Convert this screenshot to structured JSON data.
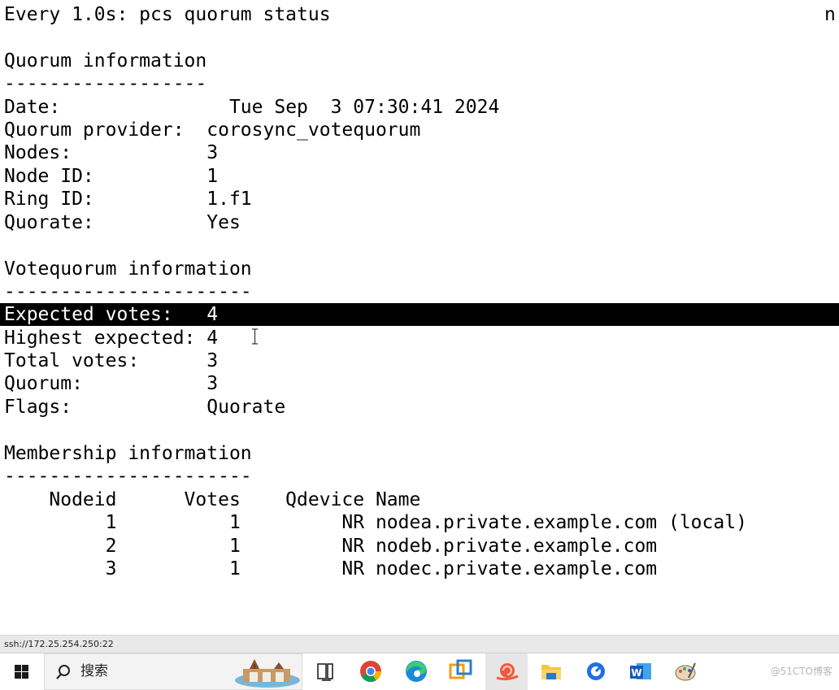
{
  "terminal": {
    "header": "Every 1.0s: pcs quorum status",
    "header_right": "n",
    "quorum_title": "Quorum information",
    "quorum_sep": "------------------",
    "quorum_rows": [
      {
        "label": "Date:               ",
        "value": "Tue Sep  3 07:30:41 2024"
      },
      {
        "label": "Quorum provider:  ",
        "value": "corosync_votequorum"
      },
      {
        "label": "Nodes:            ",
        "value": "3"
      },
      {
        "label": "Node ID:          ",
        "value": "1"
      },
      {
        "label": "Ring ID:          ",
        "value": "1.f1"
      },
      {
        "label": "Quorate:          ",
        "value": "Yes"
      }
    ],
    "vote_title": "Votequorum information",
    "vote_sep": "----------------------",
    "vote_rows": [
      {
        "label": "Expected votes:   ",
        "value": "4"
      },
      {
        "label": "Highest expected: ",
        "value": "4"
      },
      {
        "label": "Total votes:      ",
        "value": "3"
      },
      {
        "label": "Quorum:           ",
        "value": "3"
      },
      {
        "label": "Flags:            ",
        "value": "Quorate"
      }
    ],
    "member_title": "Membership information",
    "member_sep": "----------------------",
    "member_header": "    Nodeid      Votes    Qdevice Name",
    "member_rows": [
      "         1          1         NR nodea.private.example.com (local)",
      "         2          1         NR nodeb.private.example.com",
      "         3          1         NR nodec.private.example.com"
    ]
  },
  "statusbar": {
    "text": "ssh://172.25.254.250:22"
  },
  "taskbar": {
    "search_label": "搜索",
    "apps": [
      {
        "name": "task-view",
        "icon": "task-view-icon"
      },
      {
        "name": "chrome",
        "icon": "chrome-icon"
      },
      {
        "name": "edge",
        "icon": "edge-icon"
      },
      {
        "name": "vmware",
        "icon": "vmware-icon"
      },
      {
        "name": "snail-app",
        "icon": "snail-icon"
      },
      {
        "name": "file-explorer",
        "icon": "folder-icon"
      },
      {
        "name": "feishu",
        "icon": "feishu-icon"
      },
      {
        "name": "word",
        "icon": "word-icon"
      },
      {
        "name": "paint",
        "icon": "paint-icon"
      }
    ],
    "watermark": "@51CTO博客"
  }
}
